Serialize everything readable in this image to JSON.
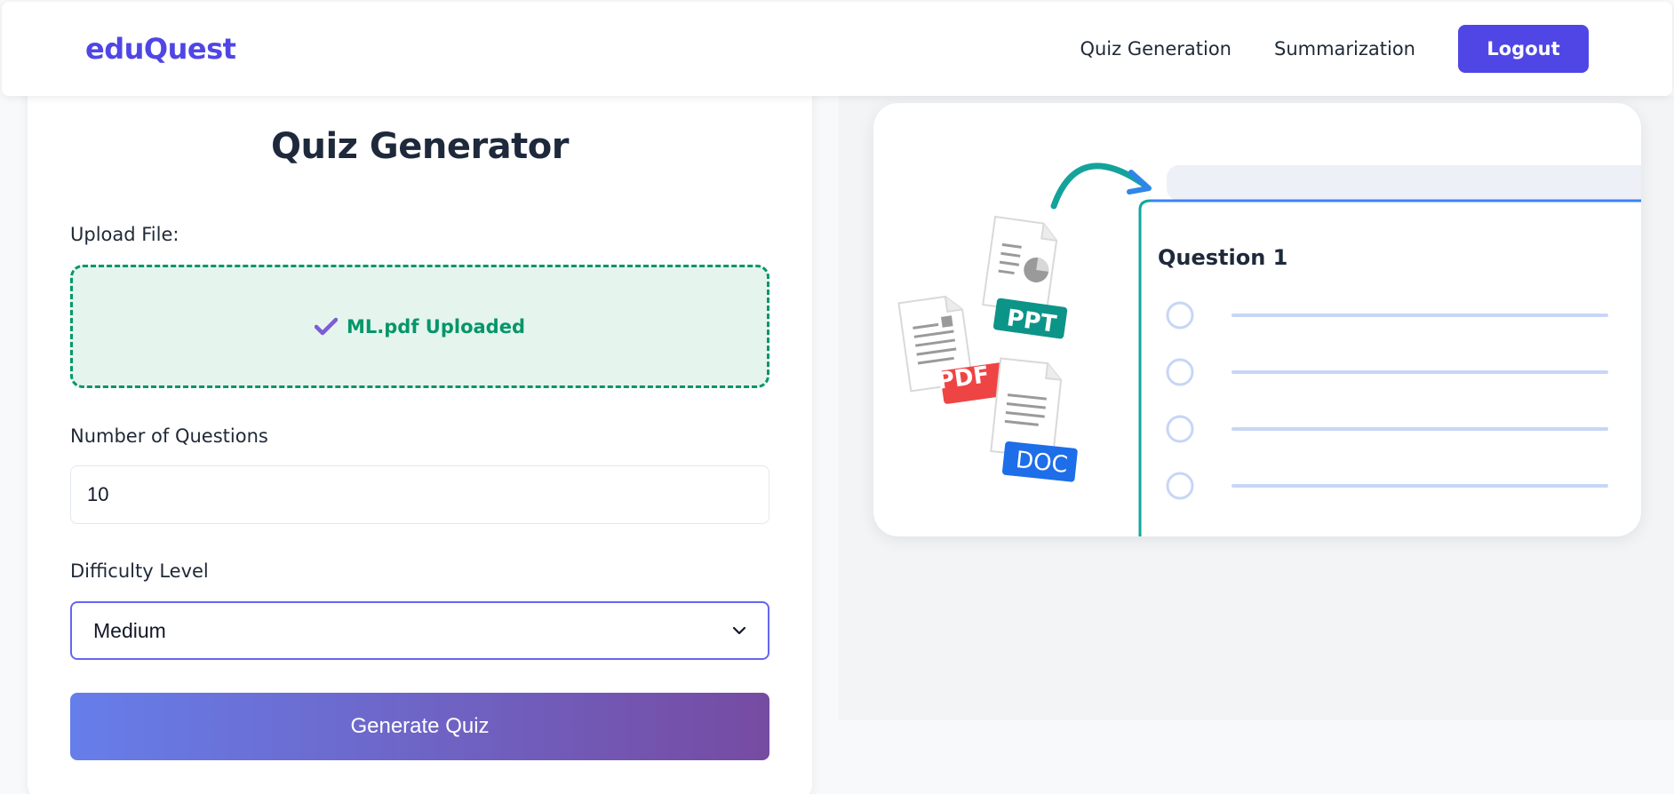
{
  "navbar": {
    "brand": "eduQuest",
    "links": [
      "Quiz Generation",
      "Summarization"
    ],
    "logout_label": "Logout"
  },
  "form": {
    "title": "Quiz Generator",
    "upload_label": "Upload File:",
    "upload_status": "ML.pdf Uploaded",
    "num_questions_label": "Number of Questions",
    "num_questions_value": "10",
    "difficulty_label": "Difficulty Level",
    "difficulty_value": "Medium",
    "generate_label": "Generate Quiz"
  },
  "illustration": {
    "question_title": "Question 1",
    "badges": [
      "PPT",
      "PDF",
      "DOC"
    ],
    "option_count": 4
  },
  "colors": {
    "brand": "#5046e5",
    "logout_bg": "#4f46e5",
    "upload_green": "#059669",
    "upload_bg": "#e6f4ee",
    "select_border": "#6366f1",
    "gradient_start": "#667eea",
    "gradient_end": "#764ba2",
    "ppt_badge": "#0d9488",
    "pdf_badge": "#ef4444",
    "doc_badge": "#1d6ee8"
  },
  "icons": {
    "upload_status_icon": "check-icon",
    "select_icon": "chevron-down-icon"
  }
}
